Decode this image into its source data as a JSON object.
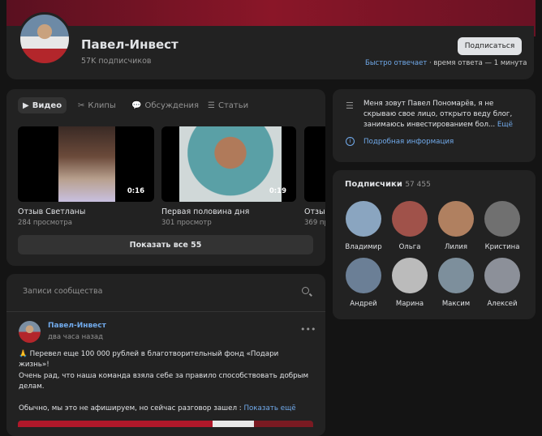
{
  "header": {
    "name": "Павел-Инвест",
    "subscribers": "57K подписчиков",
    "subscribe_label": "Подписаться",
    "response_fast": "Быстро отвечает",
    "response_time": " · время ответа — 1 минута"
  },
  "tabs": [
    {
      "label": "Видео",
      "icon": "video-icon"
    },
    {
      "label": "Клипы",
      "icon": "clips-icon"
    },
    {
      "label": "Обсуждения",
      "icon": "discussions-icon"
    },
    {
      "label": "Статьи",
      "icon": "articles-icon"
    }
  ],
  "videos": [
    {
      "title": "Отзыв Светланы",
      "views": "284 просмотра",
      "duration": "0:16"
    },
    {
      "title": "Первая половина дня",
      "views": "301 просмотр",
      "duration": "0:19"
    },
    {
      "title": "Отзыв",
      "views": "369 пр",
      "duration": ""
    }
  ],
  "show_all": "Показать все 55",
  "about": {
    "text": "Меня зовут Павел Пономарёв, я не скрываю свое лицо, открыто веду блог, занимаюсь инвестированием бол...",
    "more": " Ещё",
    "details": "Подробная информация"
  },
  "subscribers": {
    "title": "Подписчики",
    "count": "57 455",
    "people": [
      {
        "name": "Владимир",
        "color": "#8aa5c0"
      },
      {
        "name": "Ольга",
        "color": "#a0524a"
      },
      {
        "name": "Лилия",
        "color": "#b08060"
      },
      {
        "name": "Кристина",
        "color": "#707070"
      },
      {
        "name": "Андрей",
        "color": "#6b7f96"
      },
      {
        "name": "Марина",
        "color": "#bbbbbb"
      },
      {
        "name": "Максим",
        "color": "#7d8f9c"
      },
      {
        "name": "Алексей",
        "color": "#8c9099"
      }
    ]
  },
  "posts": {
    "search_placeholder": "Записи сообщества",
    "author": "Павел-Инвест",
    "time": "два часа назад",
    "line1": "🙏 Перевел еще 100 000 рублей в благотворительный фонд «Подари жизнь»!",
    "line2": "Очень рад, что наша команда взяла себе за правило способствовать добрым делам.",
    "line3": "Обычно, мы это не афишируем, но сейчас разговор зашел :",
    "more": " Показать ещё"
  },
  "colors": {
    "accent": "#71aaeb",
    "banner": "#8a1628",
    "card": "#222222"
  }
}
